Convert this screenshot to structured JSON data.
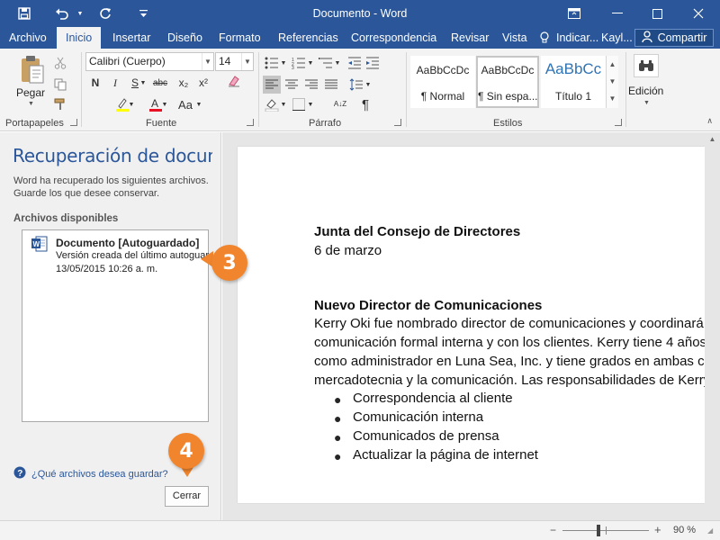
{
  "titlebar": {
    "title": "Documento  -  Word"
  },
  "tabs": [
    {
      "label": "Archivo"
    },
    {
      "label": "Inicio"
    },
    {
      "label": "Insertar"
    },
    {
      "label": "Diseño"
    },
    {
      "label": "Formato"
    },
    {
      "label": "Referencias"
    },
    {
      "label": "Correspondencia"
    },
    {
      "label": "Revisar"
    },
    {
      "label": "Vista"
    }
  ],
  "tell_me": "Indicar...",
  "user": "Kayl...",
  "share_label": "Compartir",
  "ribbon": {
    "clipboard": {
      "paste_label": "Pegar",
      "group_label": "Portapapeles"
    },
    "font": {
      "font_name": "Calibri (Cuerpo)",
      "font_size": "14",
      "group_label": "Fuente",
      "bold": "N",
      "italic": "I",
      "underline": "S",
      "strike": "abc",
      "sub": "x₂",
      "sup": "x²",
      "case": "Aa"
    },
    "paragraph": {
      "group_label": "Párrafo",
      "sort": "A↓Z",
      "pilcrow": "¶"
    },
    "styles": {
      "group_label": "Estilos",
      "items": [
        {
          "sample": "AaBbCcDc",
          "name": "¶ Normal"
        },
        {
          "sample": "AaBbCcDc",
          "name": "¶ Sin espa..."
        },
        {
          "sample": "AaBbCc",
          "name": "Título 1"
        }
      ]
    },
    "editing": {
      "label": "Edición"
    }
  },
  "pane": {
    "title": "Recuperación de documentos",
    "description": "Word ha recuperado los siguientes archivos. Guarde los que desee conservar.",
    "files_label": "Archivos disponibles",
    "files": [
      {
        "name": "Documento    [Autoguardado]",
        "line1": "Versión creada del último autoguardado",
        "line2": "13/05/2015 10:26 a. m."
      }
    ],
    "help_link": "¿Qué archivos desea guardar?",
    "close_label": "Cerrar"
  },
  "document": {
    "heading1": "Junta del Consejo de Directores",
    "date": "6 de marzo",
    "heading2": "Nuevo Director de Comunicaciones",
    "para": [
      "Kerry Oki fue nombrado director de comunicaciones y coordinará",
      "comunicación formal interna y con los clientes. Kerry tiene 4 años",
      "como administrador en Luna Sea, Inc. y tiene grados en ambas c",
      "mercadotecnia y la comunicación. Las responsabilidades de Kerry"
    ],
    "bullets": [
      "Correspondencia al cliente",
      "Comunicación interna",
      "Comunicados de prensa",
      "Actualizar la página de internet"
    ]
  },
  "statusbar": {
    "zoom": "90 %"
  },
  "callouts": [
    {
      "number": "3"
    },
    {
      "number": "4"
    }
  ],
  "colors": {
    "accent": "#2b579a",
    "callout": "#f0852d",
    "word_icon": "#2b579a"
  }
}
